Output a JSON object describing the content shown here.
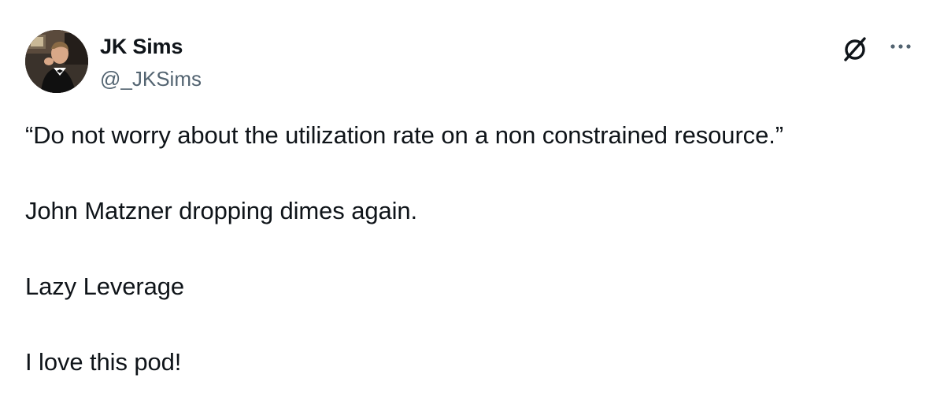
{
  "author": {
    "display_name": "JK Sims",
    "handle": "@_JKSims",
    "avatar_icon": "profile-photo-man-in-tuxedo"
  },
  "actions": {
    "grok_icon": "grok-icon",
    "more_icon": "more-options-icon"
  },
  "tweet": {
    "paragraphs": [
      "“Do not worry about the utilization rate on a non constrained resource.”",
      "John Matzner dropping dimes again.",
      "Lazy Leverage",
      "I love this pod!"
    ]
  },
  "colors": {
    "text": "#0f1419",
    "secondary_text": "#536471",
    "background": "#ffffff"
  }
}
